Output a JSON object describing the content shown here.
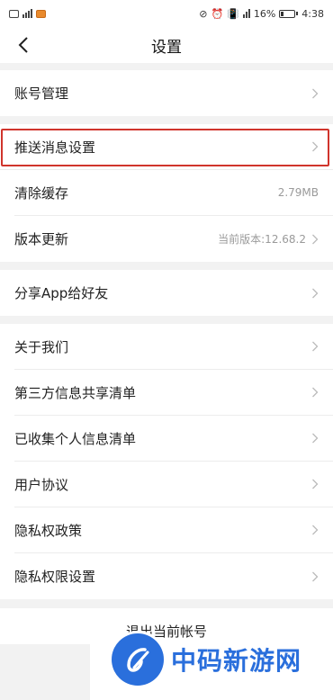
{
  "status_bar": {
    "battery": "16%",
    "time": "4:38"
  },
  "nav": {
    "title": "设置"
  },
  "groups": [
    {
      "items": [
        {
          "label": "账号管理",
          "value": ""
        }
      ]
    },
    {
      "items": [
        {
          "label": "推送消息设置",
          "value": "",
          "highlighted": true
        },
        {
          "label": "清除缓存",
          "value": "2.79MB"
        },
        {
          "label": "版本更新",
          "value": "当前版本:12.68.2"
        }
      ]
    },
    {
      "items": [
        {
          "label": "分享App给好友",
          "value": ""
        }
      ]
    },
    {
      "items": [
        {
          "label": "关于我们",
          "value": ""
        },
        {
          "label": "第三方信息共享清单",
          "value": ""
        },
        {
          "label": "已收集个人信息清单",
          "value": ""
        },
        {
          "label": "用户协议",
          "value": ""
        },
        {
          "label": "隐私权政策",
          "value": ""
        },
        {
          "label": "隐私权限设置",
          "value": ""
        }
      ]
    }
  ],
  "logout": {
    "label": "退出当前帐号"
  },
  "watermark": {
    "text": "中码新游网"
  },
  "colors": {
    "highlight": "#d0342c",
    "watermark": "#2a6fdc"
  }
}
